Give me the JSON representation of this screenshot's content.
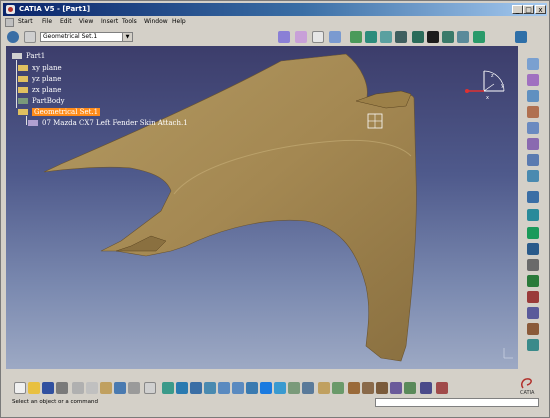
{
  "window": {
    "title": "CATIA V5 - [Part1]",
    "min_label": "_",
    "max_label": "□",
    "close_label": "x"
  },
  "menu": {
    "items": [
      "Start",
      "File",
      "Edit",
      "View",
      "Insert",
      "Tools",
      "Window",
      "Help"
    ]
  },
  "toolbar": {
    "geometrical_set_selector": "Geometrical Set.1",
    "dropdown_arrow": "▼"
  },
  "tree": {
    "root": "Part1",
    "items": [
      "xy plane",
      "yz plane",
      "zx plane",
      "PartBody",
      "Geometrical Set.1",
      "07 Mazda CX7 Left Fender Skin Attach.1"
    ]
  },
  "compass": {
    "x_label": "x",
    "y_label": "y",
    "z_label": "z"
  },
  "status": {
    "message": "Select an object or a command",
    "command_input": ""
  },
  "brand": {
    "logo_text": "CATIA"
  },
  "colors": {
    "viewport_top": "#3c3d6b",
    "viewport_bottom": "#9da9c4",
    "fender": "#a48852",
    "selection": "#ff8c1a"
  }
}
